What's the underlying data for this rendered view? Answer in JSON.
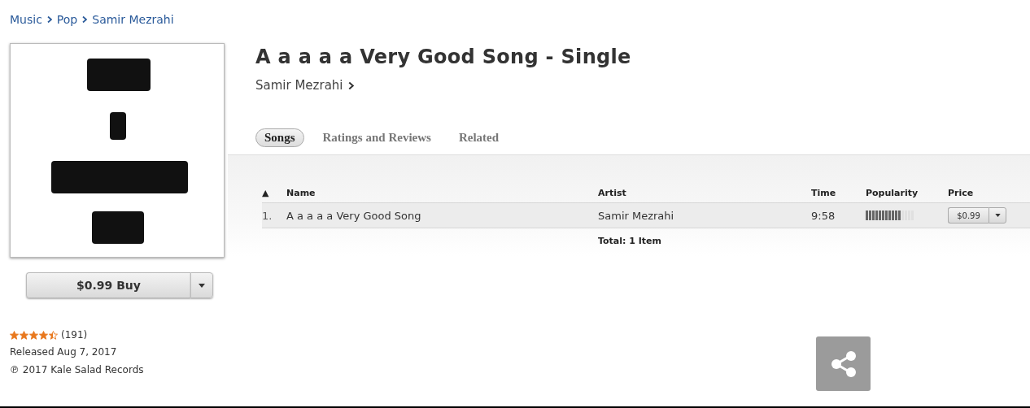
{
  "breadcrumb": [
    "Music",
    "Pop",
    "Samir Mezrahi"
  ],
  "album": {
    "kind": "picture",
    "buy_label": "$0.99 Buy",
    "stars": 4.5,
    "rating_count": "(191)",
    "released": "Released Aug 7, 2017",
    "copyright": "℗ 2017 Kale Salad Records"
  },
  "title": "A a a a a Very Good Song - Single",
  "artist": "Samir Mezrahi",
  "tabs": [
    {
      "label": "Songs",
      "selected": true
    },
    {
      "label": "Ratings and Reviews",
      "selected": false
    },
    {
      "label": "Related",
      "selected": false
    }
  ],
  "table": {
    "columns": [
      "▲",
      "Name",
      "Artist",
      "Time",
      "Popularity",
      "Price"
    ],
    "rows": [
      {
        "number": "1.",
        "name": "A a a a a Very Good Song",
        "artist": "Samir Mezrahi",
        "time": "9:58",
        "popularity": {
          "level": 0.72
        },
        "price": "$0.99"
      }
    ],
    "total": "Total: 1 Item"
  }
}
